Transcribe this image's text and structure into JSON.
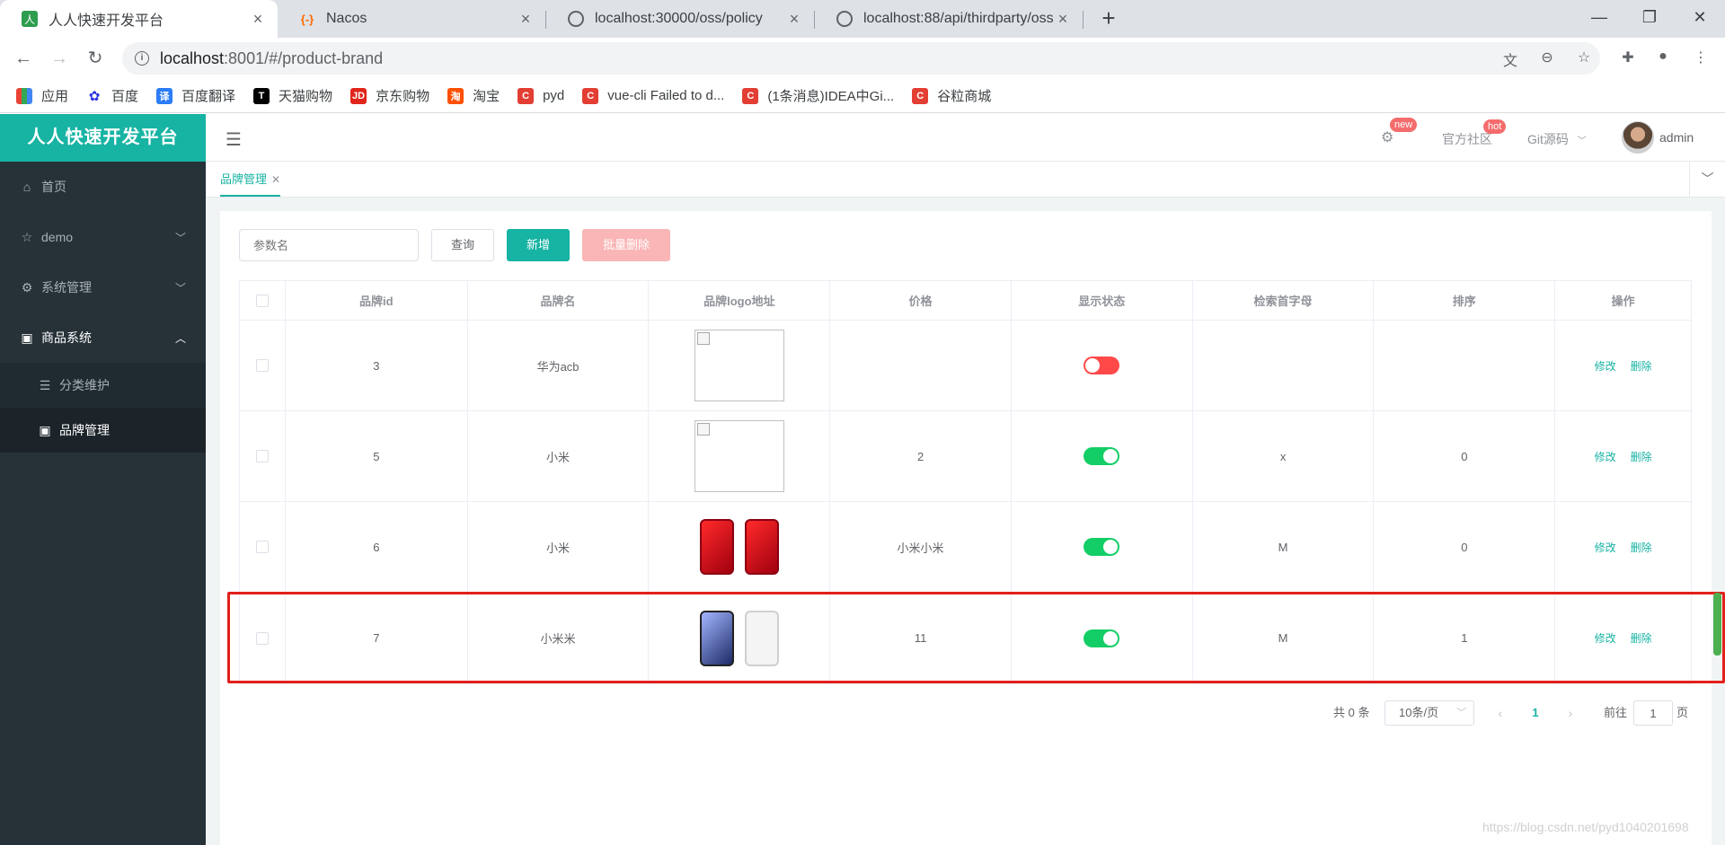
{
  "browser": {
    "tabs": [
      {
        "title": "人人快速开发平台",
        "favicon": "人",
        "color": "#2e9d4f",
        "active": true
      },
      {
        "title": "Nacos",
        "favicon": "{-}",
        "color": "#ff6a00",
        "active": false
      },
      {
        "title": "localhost:30000/oss/policy",
        "favicon": "globe-icon",
        "color": "#5f6368",
        "active": false
      },
      {
        "title": "localhost:88/api/thirdparty/oss",
        "favicon": "globe-icon",
        "color": "#5f6368",
        "active": false
      }
    ],
    "url_host": "localhost",
    "url_rest": ":8001/#/product-brand",
    "bookmarks": [
      {
        "label": "应用",
        "icon": "apps-grid-icon",
        "color": "#4285f4"
      },
      {
        "label": "百度",
        "icon": "baidu-paw-icon",
        "color": "#2932e1"
      },
      {
        "label": "百度翻译",
        "icon": "translate-icon",
        "color": "#2b7cf6"
      },
      {
        "label": "天猫购物",
        "icon": "tmall-icon",
        "color": "#000000"
      },
      {
        "label": "京东购物",
        "icon": "jd-icon",
        "color": "#e1251b"
      },
      {
        "label": "淘宝",
        "icon": "taobao-icon",
        "color": "#ff5000"
      },
      {
        "label": "pyd",
        "icon": "csdn-icon",
        "color": "#e33e33"
      },
      {
        "label": "vue-cli Failed to d...",
        "icon": "csdn-icon",
        "color": "#e33e33"
      },
      {
        "label": "(1条消息)IDEA中Gi...",
        "icon": "csdn-icon",
        "color": "#e33e33"
      },
      {
        "label": "谷粒商城",
        "icon": "csdn-icon",
        "color": "#e33e33"
      }
    ]
  },
  "app": {
    "logo": "人人快速开发平台",
    "menu": [
      {
        "label": "首页",
        "icon": "home-icon"
      },
      {
        "label": "demo",
        "icon": "star-icon",
        "has_arrow": true
      },
      {
        "label": "系统管理",
        "icon": "gear-icon",
        "has_arrow": true
      },
      {
        "label": "商品系统",
        "icon": "product-icon",
        "has_arrow": true,
        "open": true
      }
    ],
    "submenu": [
      {
        "label": "分类维护",
        "icon": "list-icon",
        "active": false
      },
      {
        "label": "品牌管理",
        "icon": "product-icon",
        "active": true
      }
    ],
    "topnav": {
      "community": "官方社区",
      "git": "Git源码",
      "badge_new": "new",
      "badge_hot": "hot",
      "user": "admin"
    },
    "page_tab": "品牌管理"
  },
  "toolbar": {
    "search_placeholder": "参数名",
    "query": "查询",
    "add": "新增",
    "batch_delete": "批量删除"
  },
  "table": {
    "headers": [
      "品牌id",
      "品牌名",
      "品牌logo地址",
      "价格",
      "显示状态",
      "检索首字母",
      "排序",
      "操作"
    ],
    "edit_label": "修改",
    "delete_label": "删除",
    "rows": [
      {
        "id": "3",
        "name": "华为acb",
        "logo": "broken",
        "price": "",
        "status": false,
        "letter": "",
        "sort": ""
      },
      {
        "id": "5",
        "name": "小米",
        "logo": "broken",
        "price": "2",
        "status": true,
        "letter": "x",
        "sort": "0"
      },
      {
        "id": "6",
        "name": "小米",
        "logo": "red-phone",
        "price": "小米小米",
        "status": true,
        "letter": "M",
        "sort": "0"
      },
      {
        "id": "7",
        "name": "小米米",
        "logo": "white-phone",
        "price": "11",
        "status": true,
        "letter": "M",
        "sort": "1"
      }
    ]
  },
  "pagination": {
    "total": "共 0 条",
    "page_size": "10条/页",
    "current": "1",
    "goto_label": "前往",
    "goto_value": "1",
    "page_suffix": "页"
  },
  "watermark": "https://blog.csdn.net/pyd1040201698",
  "colors": {
    "accent": "#17b3a3",
    "sidebar": "#263238",
    "switch_on": "#13ce66",
    "switch_off": "#ff4949",
    "highlight": "#e3201b"
  }
}
